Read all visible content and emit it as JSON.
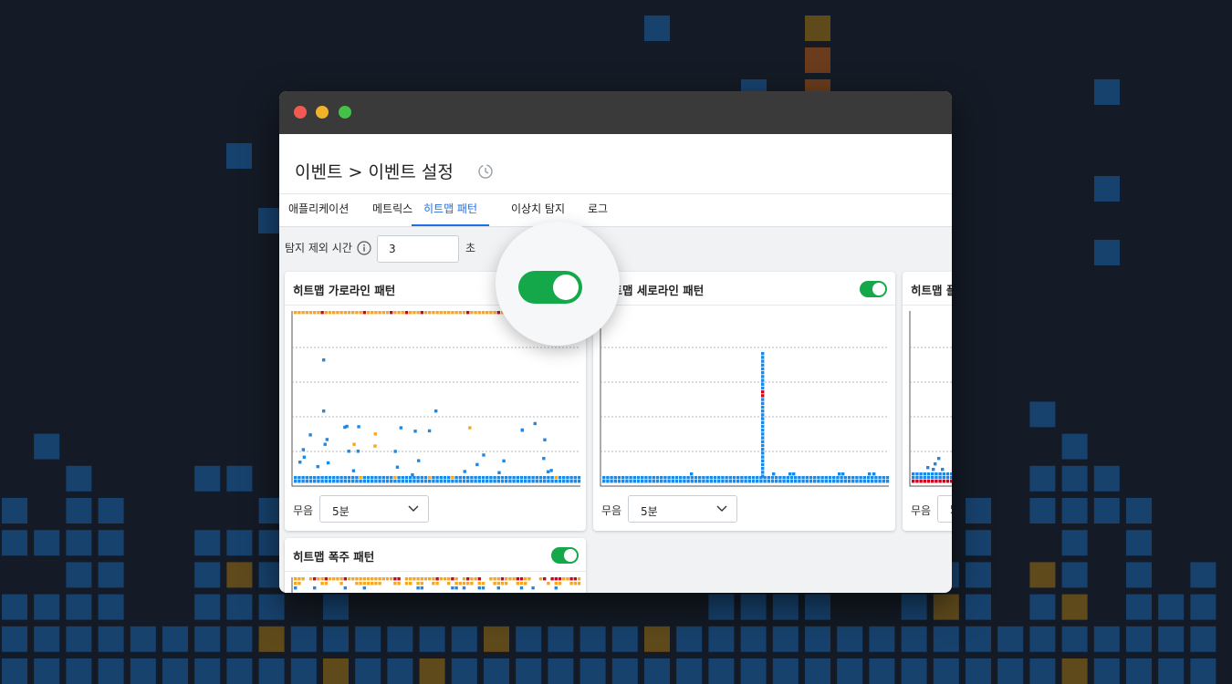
{
  "page": {
    "title": "이벤트 > 이벤트 설정",
    "accent_color": "#1f6fe0",
    "toggle_color": "#15a84a"
  },
  "tabs": [
    {
      "label": "애플리케이션",
      "active": false
    },
    {
      "label": "메트릭스",
      "active": false
    },
    {
      "label": "히트맵 패턴",
      "active": true
    },
    {
      "label": "이상치 탐지",
      "active": false
    },
    {
      "label": "로그",
      "active": false
    }
  ],
  "exclusion": {
    "label": "탐지 제외 시간",
    "value": "3",
    "unit": "초",
    "info_icon": "info-icon"
  },
  "cards": [
    {
      "title": "히트맵 가로라인 패턴",
      "enabled": true,
      "mute_label": "무음",
      "mute_value": "5분"
    },
    {
      "title": "히트맵 세로라인 패턴",
      "enabled": true,
      "mute_label": "무음",
      "mute_value": "5분"
    },
    {
      "title": "히트맵 플",
      "enabled": true,
      "mute_label": "무음",
      "mute_value": "5"
    },
    {
      "title": "히트맵 폭주 패턴",
      "enabled": true
    }
  ],
  "magnifier": {
    "toggle_enabled": true
  },
  "heatmap_colors": {
    "normal": "#1e88e5",
    "warning": "#f5a623",
    "critical": "#d0021b",
    "fatal": "#7a0015"
  }
}
